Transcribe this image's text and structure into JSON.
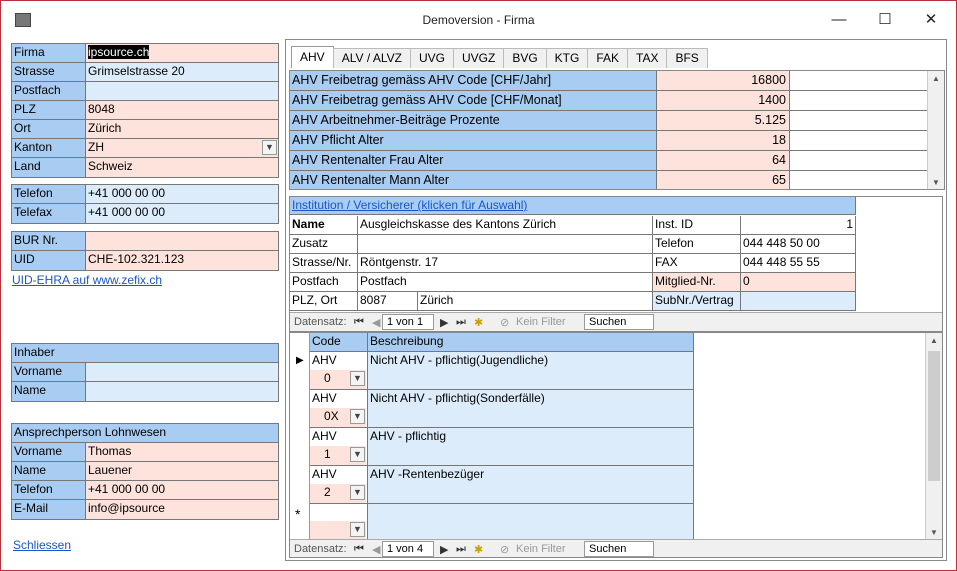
{
  "window": {
    "title": "Demoversion - Firma",
    "minimize": "—",
    "maximize": "☐",
    "close": "✕"
  },
  "firm": {
    "rows": [
      {
        "label": "Firma",
        "value": "ipsource.ch",
        "color": "pink"
      },
      {
        "label": "Strasse",
        "value": "Grimselstrasse 20",
        "color": "blue"
      },
      {
        "label": "Postfach",
        "value": "",
        "color": "blue"
      },
      {
        "label": "PLZ",
        "value": "8048",
        "color": "pink"
      },
      {
        "label": "Ort",
        "value": "Zürich",
        "color": "pink"
      },
      {
        "label": "Kanton",
        "value": "ZH",
        "color": "pink"
      },
      {
        "label": "Land",
        "value": "Schweiz",
        "color": "pink"
      }
    ]
  },
  "contact": {
    "rows": [
      {
        "label": "Telefon",
        "value": "+41 000 00 00"
      },
      {
        "label": "Telefax",
        "value": "+41 000 00 00"
      }
    ]
  },
  "ids": {
    "rows": [
      {
        "label": "BUR Nr.",
        "value": ""
      },
      {
        "label": "UID",
        "value": "CHE-102.321.123"
      }
    ]
  },
  "uid_link": "UID-EHRA auf www.zefix.ch",
  "owner": {
    "header": "Inhaber",
    "rows": [
      {
        "label": "Vorname",
        "value": ""
      },
      {
        "label": "Name",
        "value": ""
      }
    ]
  },
  "payroll_contact": {
    "header": "Ansprechperson Lohnwesen",
    "rows": [
      {
        "label": "Vorname",
        "value": "Thomas"
      },
      {
        "label": "Name",
        "value": "Lauener"
      },
      {
        "label": "Telefon",
        "value": "+41 000 00 00"
      },
      {
        "label": "E-Mail",
        "value": "info@ipsource"
      }
    ]
  },
  "close_link": "Schliessen",
  "tabs": [
    "AHV",
    "ALV / ALVZ",
    "UVG",
    "UVGZ",
    "BVG",
    "KTG",
    "FAK",
    "TAX",
    "BFS"
  ],
  "ahv_params": [
    {
      "label": "AHV Freibetrag gemäss AHV Code [CHF/Jahr]",
      "value": "16800"
    },
    {
      "label": "AHV Freibetrag gemäss AHV Code [CHF/Monat]",
      "value": "1400"
    },
    {
      "label": "AHV Arbeitnehmer-Beiträge Prozente",
      "value": "5.125"
    },
    {
      "label": "AHV Pflicht Alter",
      "value": "18"
    },
    {
      "label": "AHV Rentenalter Frau Alter",
      "value": "64"
    },
    {
      "label": "AHV Rentenalter Mann Alter",
      "value": "65"
    }
  ],
  "institution": {
    "header": "Institution / Versicherer (klicken für Auswahl)",
    "name_label": "Name",
    "name": "Ausgleichskasse des Kantons Zürich",
    "inst_id_label": "Inst. ID",
    "inst_id": "1",
    "zusatz_label": "Zusatz",
    "zusatz": "",
    "telefon_label": "Telefon",
    "telefon": "044 448 50 00",
    "strasse_label": "Strasse/Nr.",
    "strasse": "Röntgenstr. 17",
    "fax_label": "FAX",
    "fax": "044 448 55 55",
    "postfach_label": "Postfach",
    "postfach": "Postfach",
    "mitglied_label": "Mitglied-Nr.",
    "mitglied": "0",
    "plzort_label": "PLZ, Ort",
    "plz": "8087",
    "ort": "Zürich",
    "subnr_label": "SubNr./Vertrag",
    "subnr": ""
  },
  "nav1": {
    "label": "Datensatz:",
    "pos": "1 von 1",
    "filter": "Kein Filter",
    "search": "Suchen"
  },
  "codes": {
    "col_code": "Code",
    "col_desc": "Beschreibung",
    "rows": [
      {
        "type": "AHV",
        "code": "0",
        "desc": "Nicht AHV - pflichtig(Jugendliche)"
      },
      {
        "type": "AHV",
        "code": "0X",
        "desc": "Nicht AHV - pflichtig(Sonderfälle)"
      },
      {
        "type": "AHV",
        "code": "1",
        "desc": "AHV - pflichtig"
      },
      {
        "type": "AHV",
        "code": "2",
        "desc": "AHV -Rentenbezüger"
      }
    ],
    "new_marker": "*"
  },
  "nav2": {
    "label": "Datensatz:",
    "pos": "1 von 4",
    "filter": "Kein Filter",
    "search": "Suchen"
  }
}
